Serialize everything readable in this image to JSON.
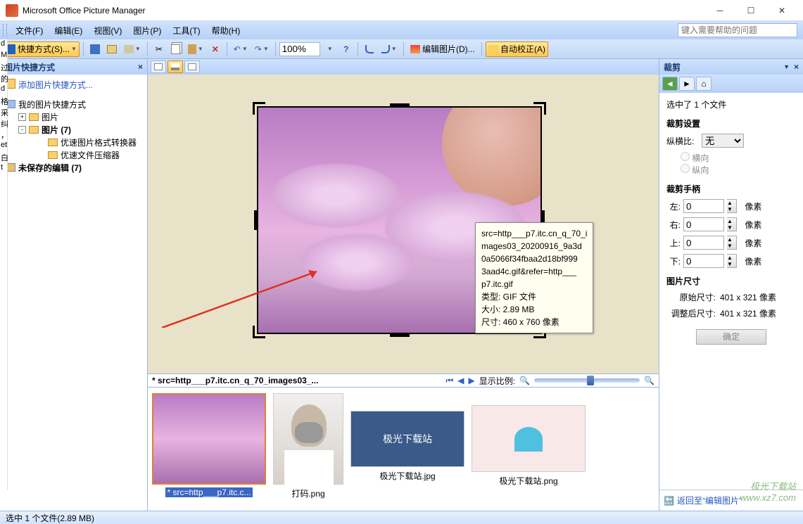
{
  "title": "Microsoft Office Picture Manager",
  "menu": {
    "file": "文件(F)",
    "edit": "编辑(E)",
    "view": "视图(V)",
    "picture": "图片(P)",
    "tools": "工具(T)",
    "help": "帮助(H)"
  },
  "helpbox_placeholder": "键入需要帮助的问题",
  "toolbar": {
    "shortcut": "快捷方式(S)...",
    "zoom": "100%",
    "edit_pic": "编辑图片(D)...",
    "auto_correct": "自动校正(A)"
  },
  "leftpane": {
    "title": "图片快捷方式",
    "addlink": "添加图片快捷方式...",
    "root": "我的图片快捷方式",
    "node_pic": "图片",
    "node_pic7": "图片 (7)",
    "node_conv": "优速图片格式转换器",
    "node_comp": "优速文件压缩器",
    "unsaved": "未保存的编辑 (7)"
  },
  "tooltip": {
    "l1": "src=http___p7.itc.cn_q_70_i",
    "l2": "mages03_20200916_9a3d",
    "l3": "0a5066f34fbaa2d18bf999",
    "l4": "3aad4c.gif&refer=http___",
    "l5": "p7.itc.gif",
    "type": "类型: GIF 文件",
    "size": "大小: 2.89 MB",
    "dim": "尺寸: 460 x 760 像素"
  },
  "filebar": {
    "name": "* src=http___p7.itc.cn_q_70_images03_...",
    "zoom_label": "显示比例:"
  },
  "thumbs": {
    "t1": "* src=http___p7.itc.c...",
    "t2": "打码.png",
    "t3": "极光下载站.jpg",
    "t4": "极光下载站.png"
  },
  "crop": {
    "title": "裁剪",
    "selected": "选中了 1 个文件",
    "settings": "裁剪设置",
    "aspect": "纵横比:",
    "aspect_val": "无",
    "orient_h": "横向",
    "orient_v": "纵向",
    "handles": "裁剪手柄",
    "left": "左:",
    "right": "右:",
    "top": "上:",
    "bottom": "下:",
    "val": "0",
    "unit": "像素",
    "picsize": "图片尺寸",
    "orig": "原始尺寸:",
    "orig_val": "401 x 321 像素",
    "after": "调整后尺寸:",
    "after_val": "401 x 321 像素",
    "ok": "确定",
    "back": "返回至“编辑图片”"
  },
  "status": "选中 1 个文件(2.89 MB)",
  "watermark": {
    "l1": "极光下载站",
    "l2": "www.xz7.com"
  },
  "leftedge": [
    "d",
    "M",
    "过",
    "的",
    "d",
    "格",
    "采",
    "纠",
    "，",
    "et",
    "白",
    "t"
  ]
}
